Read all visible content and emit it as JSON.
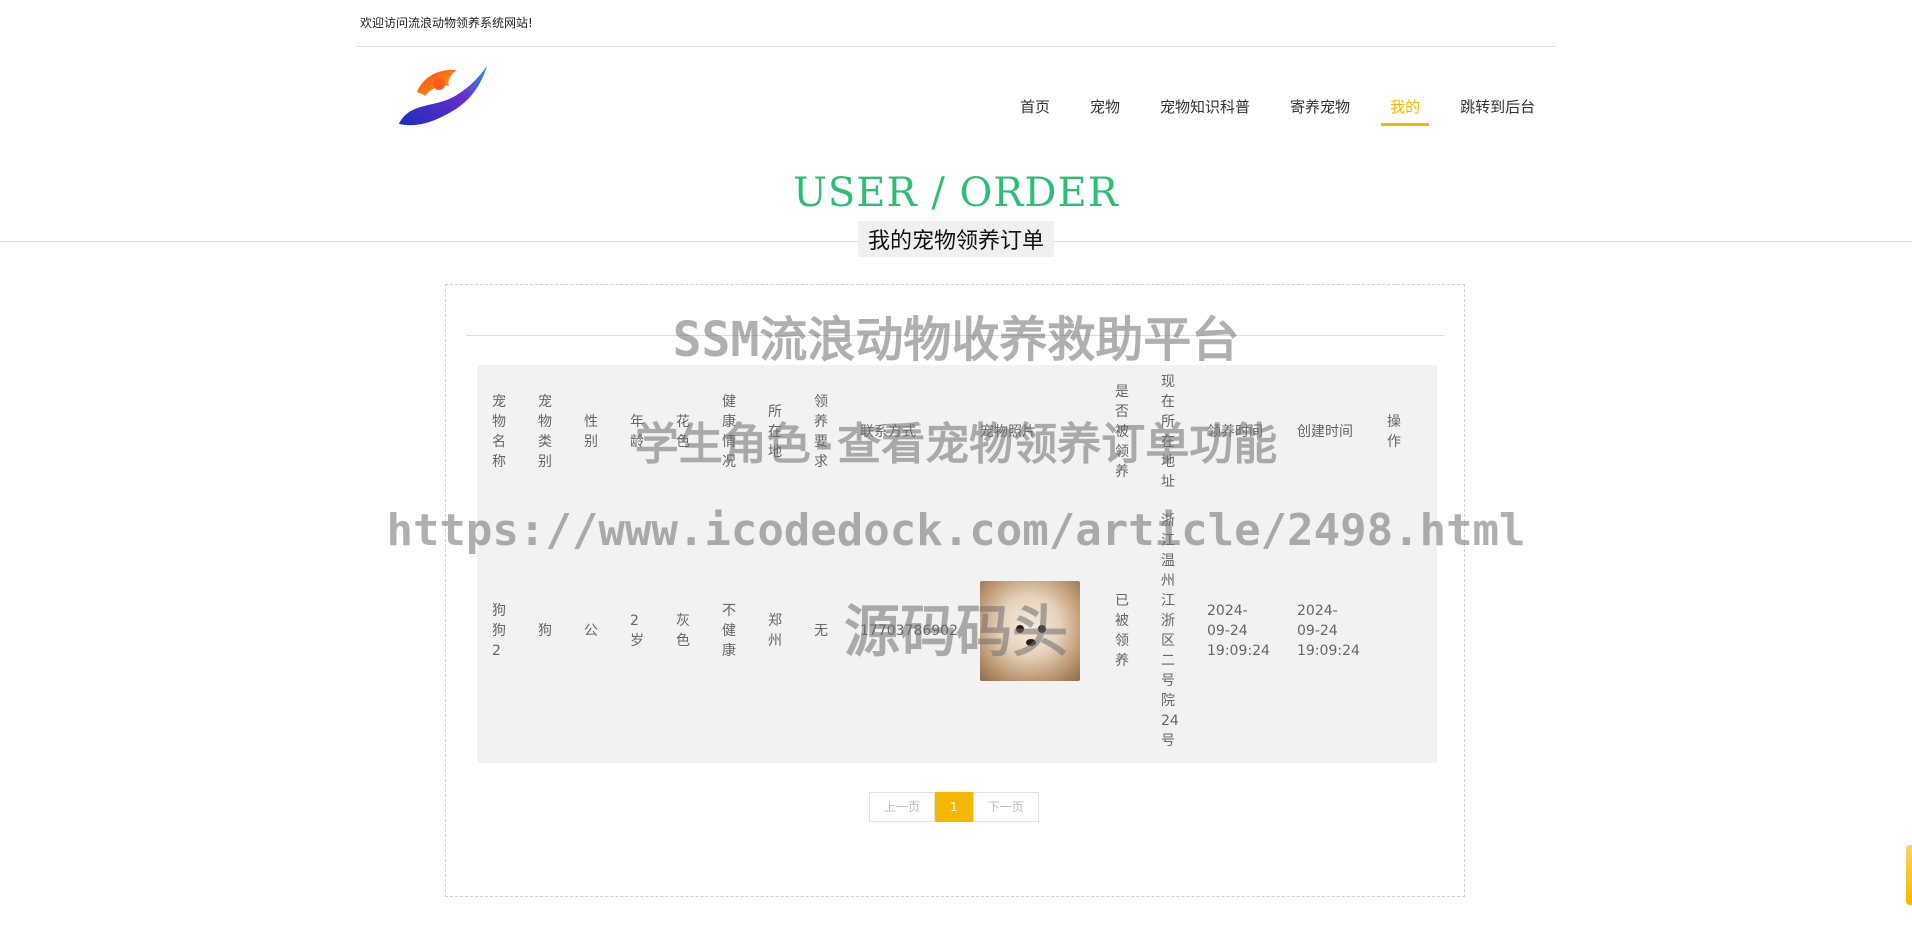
{
  "header": {
    "welcome": "欢迎访问流浪动物领养系统网站!"
  },
  "nav": {
    "items": [
      "首页",
      "宠物",
      "宠物知识科普",
      "寄养宠物",
      "我的",
      "跳转到后台"
    ],
    "active_index": 4
  },
  "page": {
    "title_en": "USER / ORDER",
    "title_cn": "我的宠物领养订单"
  },
  "table": {
    "headers": [
      "宠物名称",
      "宠物类别",
      "性别",
      "年龄",
      "花色",
      "健康情况",
      "所在地",
      "领养要求",
      "联系方式",
      "宠物照片",
      "是否被领养",
      "现在所在地址",
      "领养时间",
      "创建时间",
      "操作"
    ],
    "rows": [
      {
        "name": "狗狗2",
        "category": "狗",
        "gender": "公",
        "age": "2岁",
        "color": "灰色",
        "health": "不健康",
        "location": "郑州",
        "requirement": "无",
        "contact": "17703786902",
        "photo": "puppy-photo",
        "adopted": "已被领养",
        "address": "浙江温州江浙区二号院24号",
        "adopt_time": "2024-09-24 19:09:24",
        "created_time": "2024-09-24 19:09:24",
        "action": ""
      }
    ]
  },
  "pagination": {
    "prev": "上一页",
    "current": "1",
    "next": "下一页"
  },
  "watermark": {
    "line1": "SSM流浪动物收养救助平台",
    "line2": "学生角色-查看宠物领养订单功能",
    "line3": "https://www.icodedock.com/article/2498.html",
    "line4": "源码码头"
  },
  "colors": {
    "accent": "#f5b800",
    "title_green": "#2ebd75"
  }
}
